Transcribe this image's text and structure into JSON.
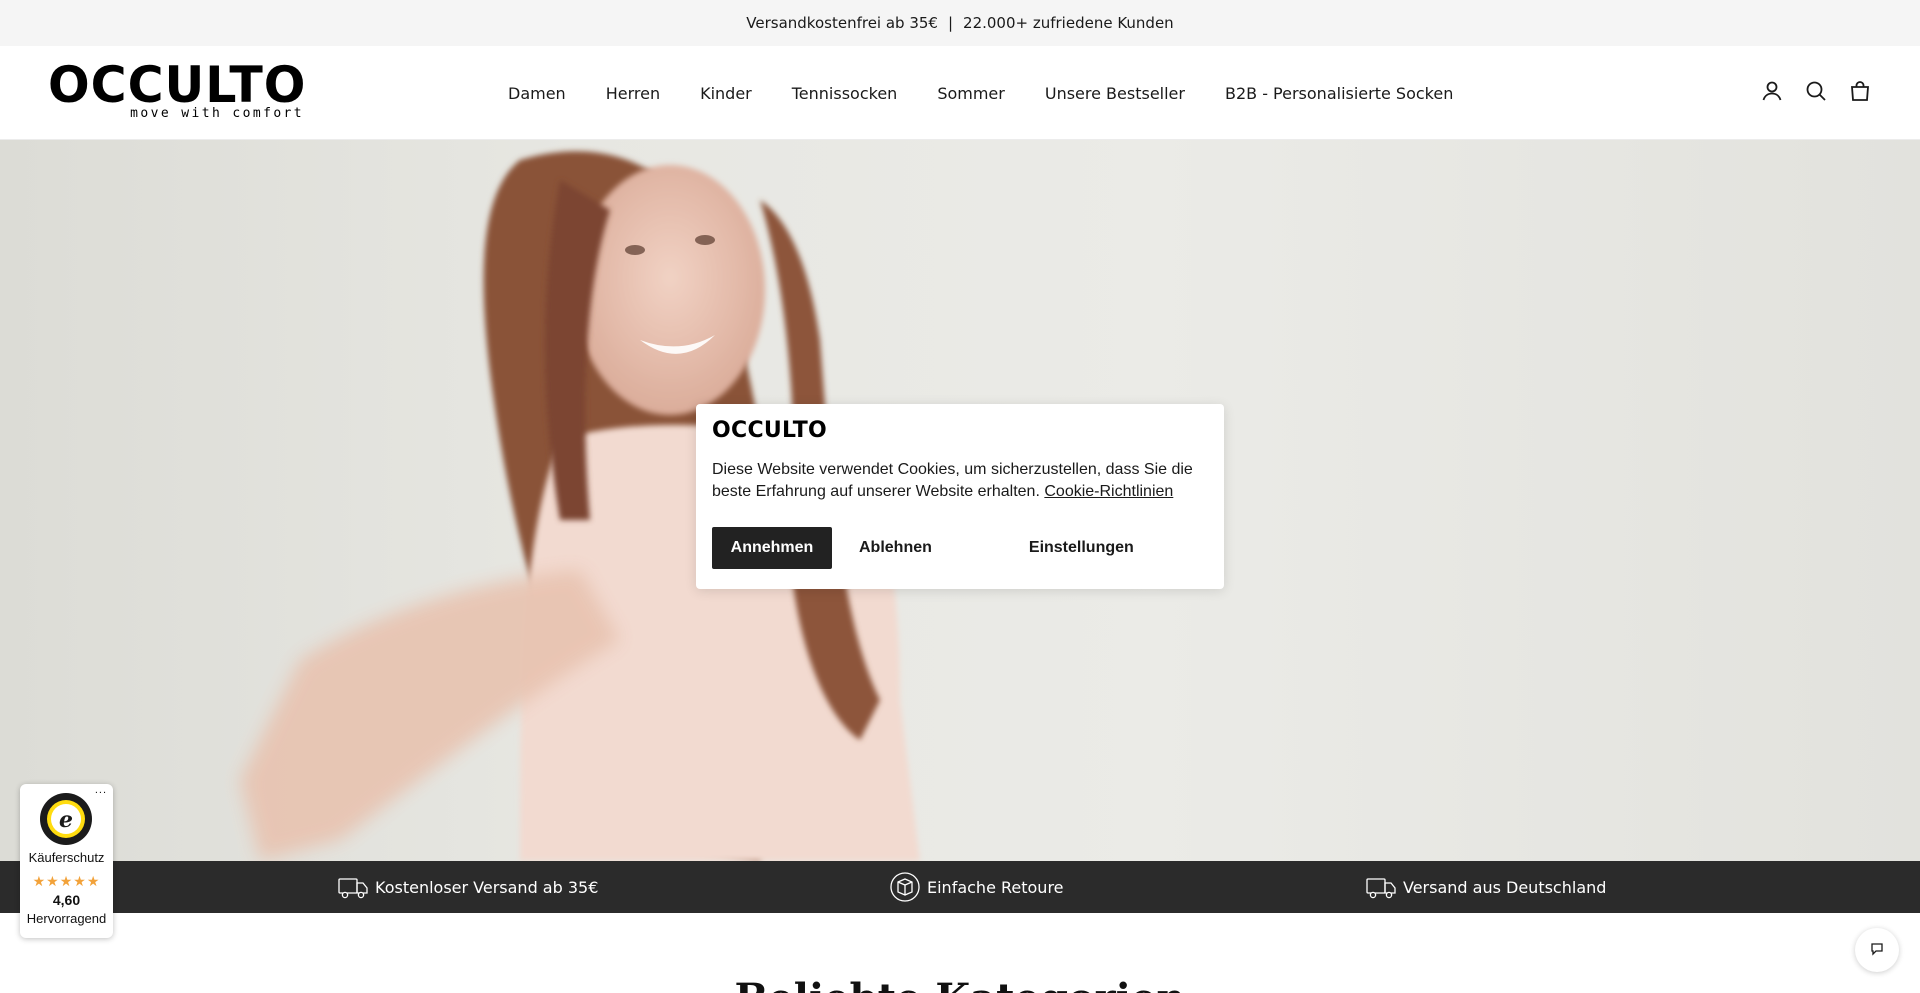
{
  "announcement": {
    "left_text": "Versandkostenfrei ab 35€",
    "separator": "|",
    "right_text": "22.000+ zufriedene Kunden"
  },
  "header": {
    "logo": {
      "word": "OCCULTO",
      "tagline": "move with comfort"
    },
    "nav": [
      {
        "label": "Damen"
      },
      {
        "label": "Herren"
      },
      {
        "label": "Kinder"
      },
      {
        "label": "Tennissocken"
      },
      {
        "label": "Sommer"
      },
      {
        "label": "Unsere Bestseller"
      },
      {
        "label": "B2B - Personalisierte Socken"
      }
    ],
    "icons": [
      "account-icon",
      "search-icon",
      "cart-icon"
    ]
  },
  "cookie_dialog": {
    "logo": "OCCULTO",
    "text": "Diese Website verwendet Cookies, um sicherzustellen, dass Sie die beste Erfahrung auf unserer Website erhalten.",
    "policy_link": "Cookie-Richtlinien",
    "accept_label": "Annehmen",
    "decline_label": "Ablehnen",
    "settings_label": "Einstellungen"
  },
  "usp_bar": {
    "items": [
      {
        "label": "Kostenloser Versand ab 35€",
        "icon": "truck-icon"
      },
      {
        "label": "Einfache Retoure",
        "icon": "return-box-icon"
      },
      {
        "label": "Versand aus Deutschland",
        "icon": "truck-icon"
      }
    ]
  },
  "section": {
    "title": "Beliebte Kategorien"
  },
  "trusted_shops": {
    "dots": "...",
    "label": "Käuferschutz",
    "stars": "★★★★★",
    "score": "4,60",
    "rating_text": "Hervorragend",
    "star_color": "#f2a23a"
  },
  "chat": {
    "icon": "chat-icon"
  },
  "colors": {
    "dark_bar": "#2b2b2b",
    "accept_button": "#222222",
    "announcement_bg": "#f5f5f5"
  }
}
